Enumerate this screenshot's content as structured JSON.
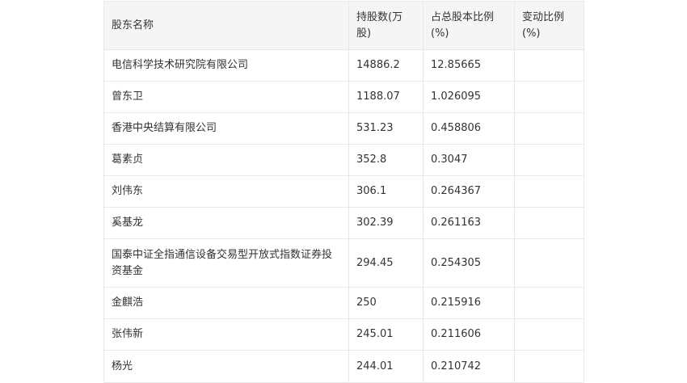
{
  "table": {
    "headers": [
      "股东名称",
      "持股数(万股)",
      "占总股本比例(%)",
      "变动比例(%)"
    ],
    "rows": [
      [
        "电信科学技术研究院有限公司",
        "14886.2",
        "12.85665",
        ""
      ],
      [
        "曾东卫",
        "1188.07",
        "1.026095",
        ""
      ],
      [
        "香港中央结算有限公司",
        "531.23",
        "0.458806",
        ""
      ],
      [
        "葛素贞",
        "352.8",
        "0.3047",
        ""
      ],
      [
        "刘伟东",
        "306.1",
        "0.264367",
        ""
      ],
      [
        "奚基龙",
        "302.39",
        "0.261163",
        ""
      ],
      [
        "国泰中证全指通信设备交易型开放式指数证券投资基金",
        "294.45",
        "0.254305",
        ""
      ],
      [
        "金麒浩",
        "250",
        "0.215916",
        ""
      ],
      [
        "张伟新",
        "245.01",
        "0.211606",
        ""
      ],
      [
        "杨光",
        "244.01",
        "0.210742",
        ""
      ]
    ]
  }
}
